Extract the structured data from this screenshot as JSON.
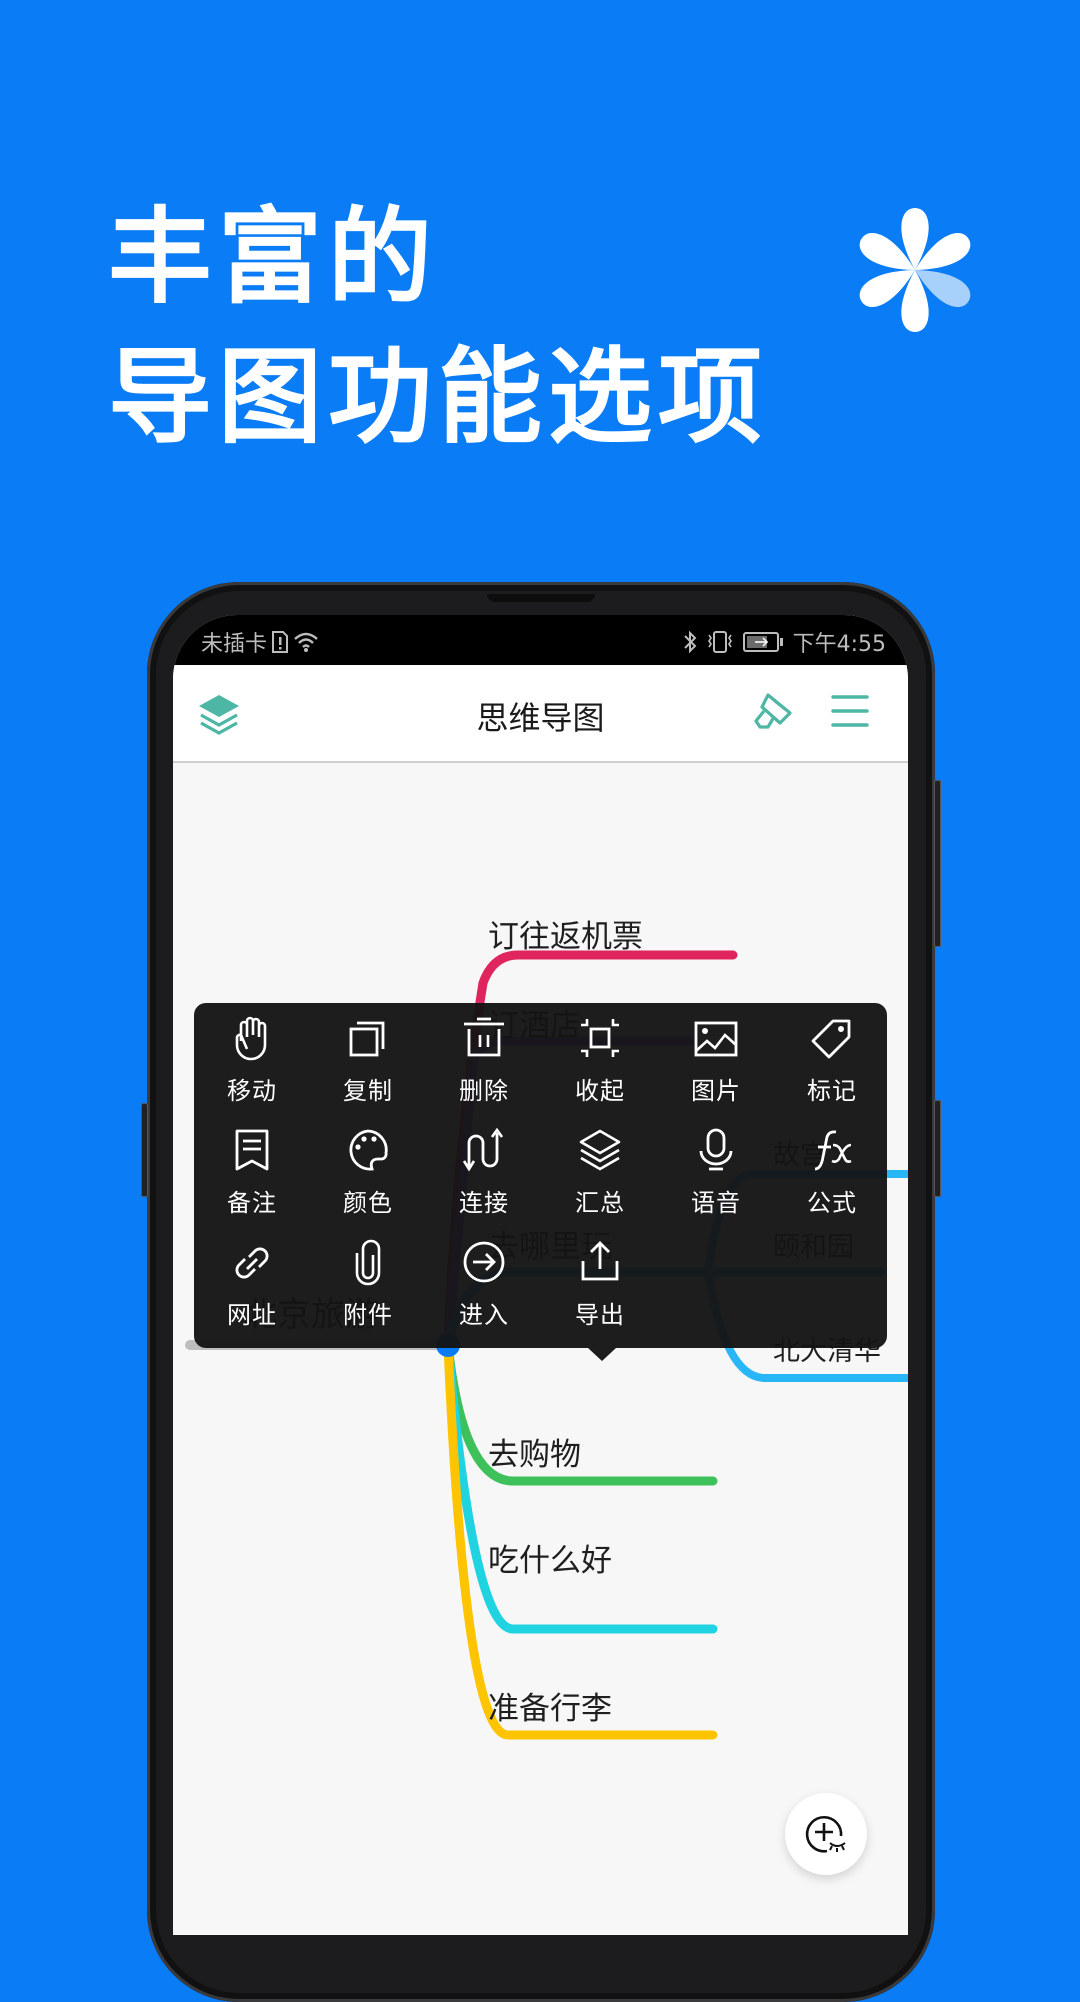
{
  "promo": {
    "headline_line1": "丰富的",
    "headline_line2": "导图功能选项",
    "background_color": "#0a7cf5",
    "logo_icon": "flower-petal-icon"
  },
  "status_bar": {
    "carrier": "未插卡",
    "left_icons": [
      "sim-alert-icon",
      "wifi-icon"
    ],
    "right_icons": [
      "bluetooth-icon",
      "vibrate-icon",
      "battery-charging-icon"
    ],
    "time": "下午4:55"
  },
  "app_bar": {
    "title": "思维导图",
    "left_icon": "layers-icon",
    "right_icons": [
      "brush-icon",
      "menu-icon"
    ],
    "accent_color": "#4db6a4"
  },
  "context_menu": {
    "items": [
      {
        "label": "移动",
        "icon": "hand-icon"
      },
      {
        "label": "复制",
        "icon": "copy-icon"
      },
      {
        "label": "删除",
        "icon": "trash-icon"
      },
      {
        "label": "收起",
        "icon": "collapse-icon"
      },
      {
        "label": "图片",
        "icon": "image-icon"
      },
      {
        "label": "标记",
        "icon": "tag-icon"
      },
      {
        "label": "备注",
        "icon": "note-icon"
      },
      {
        "label": "颜色",
        "icon": "palette-icon"
      },
      {
        "label": "连接",
        "icon": "connect-icon"
      },
      {
        "label": "汇总",
        "icon": "summary-layers-icon"
      },
      {
        "label": "语音",
        "icon": "microphone-icon"
      },
      {
        "label": "公式",
        "icon": "formula-icon"
      },
      {
        "label": "网址",
        "icon": "link-icon"
      },
      {
        "label": "附件",
        "icon": "paperclip-icon"
      },
      {
        "label": "进入",
        "icon": "arrow-circle-right-icon"
      },
      {
        "label": "导出",
        "icon": "export-icon"
      }
    ]
  },
  "mindmap": {
    "root": "北京旅游",
    "branches": [
      {
        "label": "订往返机票",
        "color": "#e0245e"
      },
      {
        "label": "订酒店",
        "color": "#b45cf0"
      },
      {
        "label": "去哪里玩",
        "color": "#29b6f6",
        "children": [
          "故宫",
          "颐和园",
          "北大清华"
        ]
      },
      {
        "label": "去购物",
        "color": "#3ec15a"
      },
      {
        "label": "吃什么好",
        "color": "#1fd3e0"
      },
      {
        "label": "准备行李",
        "color": "#ffc400"
      }
    ],
    "root_line_color": "#bdbdbd",
    "root_dot_color": "#0a7cf5"
  },
  "fab": {
    "icon": "zoom-add-icon"
  }
}
